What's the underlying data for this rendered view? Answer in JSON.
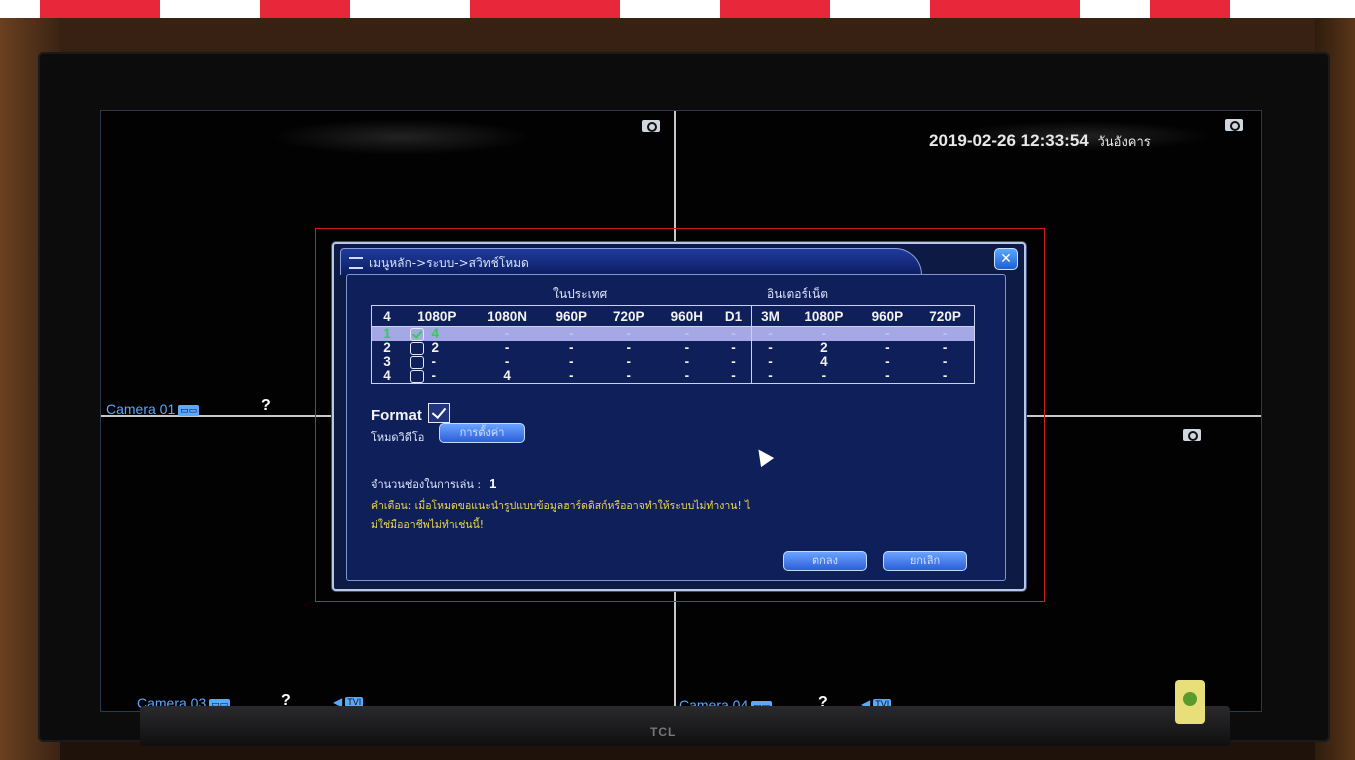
{
  "dvr": {
    "datetime": "2019-02-26 12:33:54",
    "weekday": "วันอังคาร",
    "cameras": [
      {
        "label": "Camera 01",
        "badge": "▭▭"
      },
      {
        "label": "Camera 03",
        "badge": "▭▭"
      },
      {
        "label": "Camera 04",
        "badge": "▭▭"
      }
    ],
    "help_glyph": "?",
    "tvi_badge": "TVI",
    "speaker_glyph": "◀"
  },
  "dialog": {
    "title": "เมนูหลัก->ระบบ->สวิทช์โหมด",
    "close_glyph": "✕",
    "group_domestic": "ในประเทศ",
    "group_internet": "อินเตอร์เน็ต",
    "table": {
      "headers": [
        "4",
        "1080P",
        "1080N",
        "960P",
        "720P",
        "960H",
        "D1",
        "3M",
        "1080P",
        "960P",
        "720P"
      ],
      "rows": [
        {
          "num": "1",
          "checked": true,
          "cells": [
            "4",
            "-",
            "-",
            "-",
            "-",
            "-",
            "-",
            "-",
            "-",
            "-"
          ]
        },
        {
          "num": "2",
          "checked": false,
          "cells": [
            "2",
            "-",
            "-",
            "-",
            "-",
            "-",
            "-",
            "2",
            "-",
            "-"
          ]
        },
        {
          "num": "3",
          "checked": false,
          "cells": [
            "-",
            "-",
            "-",
            "-",
            "-",
            "-",
            "-",
            "4",
            "-",
            "-"
          ]
        },
        {
          "num": "4",
          "checked": false,
          "cells": [
            "-",
            "4",
            "-",
            "-",
            "-",
            "-",
            "-",
            "-",
            "-",
            "-"
          ]
        }
      ]
    },
    "format_label": "Format",
    "format_checked": true,
    "video_mode_label": "โหมดวิดีโอ",
    "video_mode_button": "การตั้งค่า",
    "channels_label": "จำนวนช่องในการเล่น :",
    "channels_value": "1",
    "warning_line1": "คำเตือน: เมื่อโหมดขอแนะนำรูปแบบข้อมูลฮาร์ดดิสก์หรืออาจทำให้ระบบไม่ทำงาน! ไ",
    "warning_line2": "ม่ใช่มืออาชีพไม่ทำเช่นนี้!",
    "ok_button": "ตกลง",
    "cancel_button": "ยกเลิก"
  },
  "monitor": {
    "brand": "TCL"
  },
  "colors": {
    "dialog_bg": "#0d1a44",
    "accent_blue": "#5aa8ff",
    "selected_row": "#a6a8e6",
    "warning_text": "#f0d84a",
    "check_green": "#2fd04f",
    "highlight_frame": "#d41b1b"
  }
}
